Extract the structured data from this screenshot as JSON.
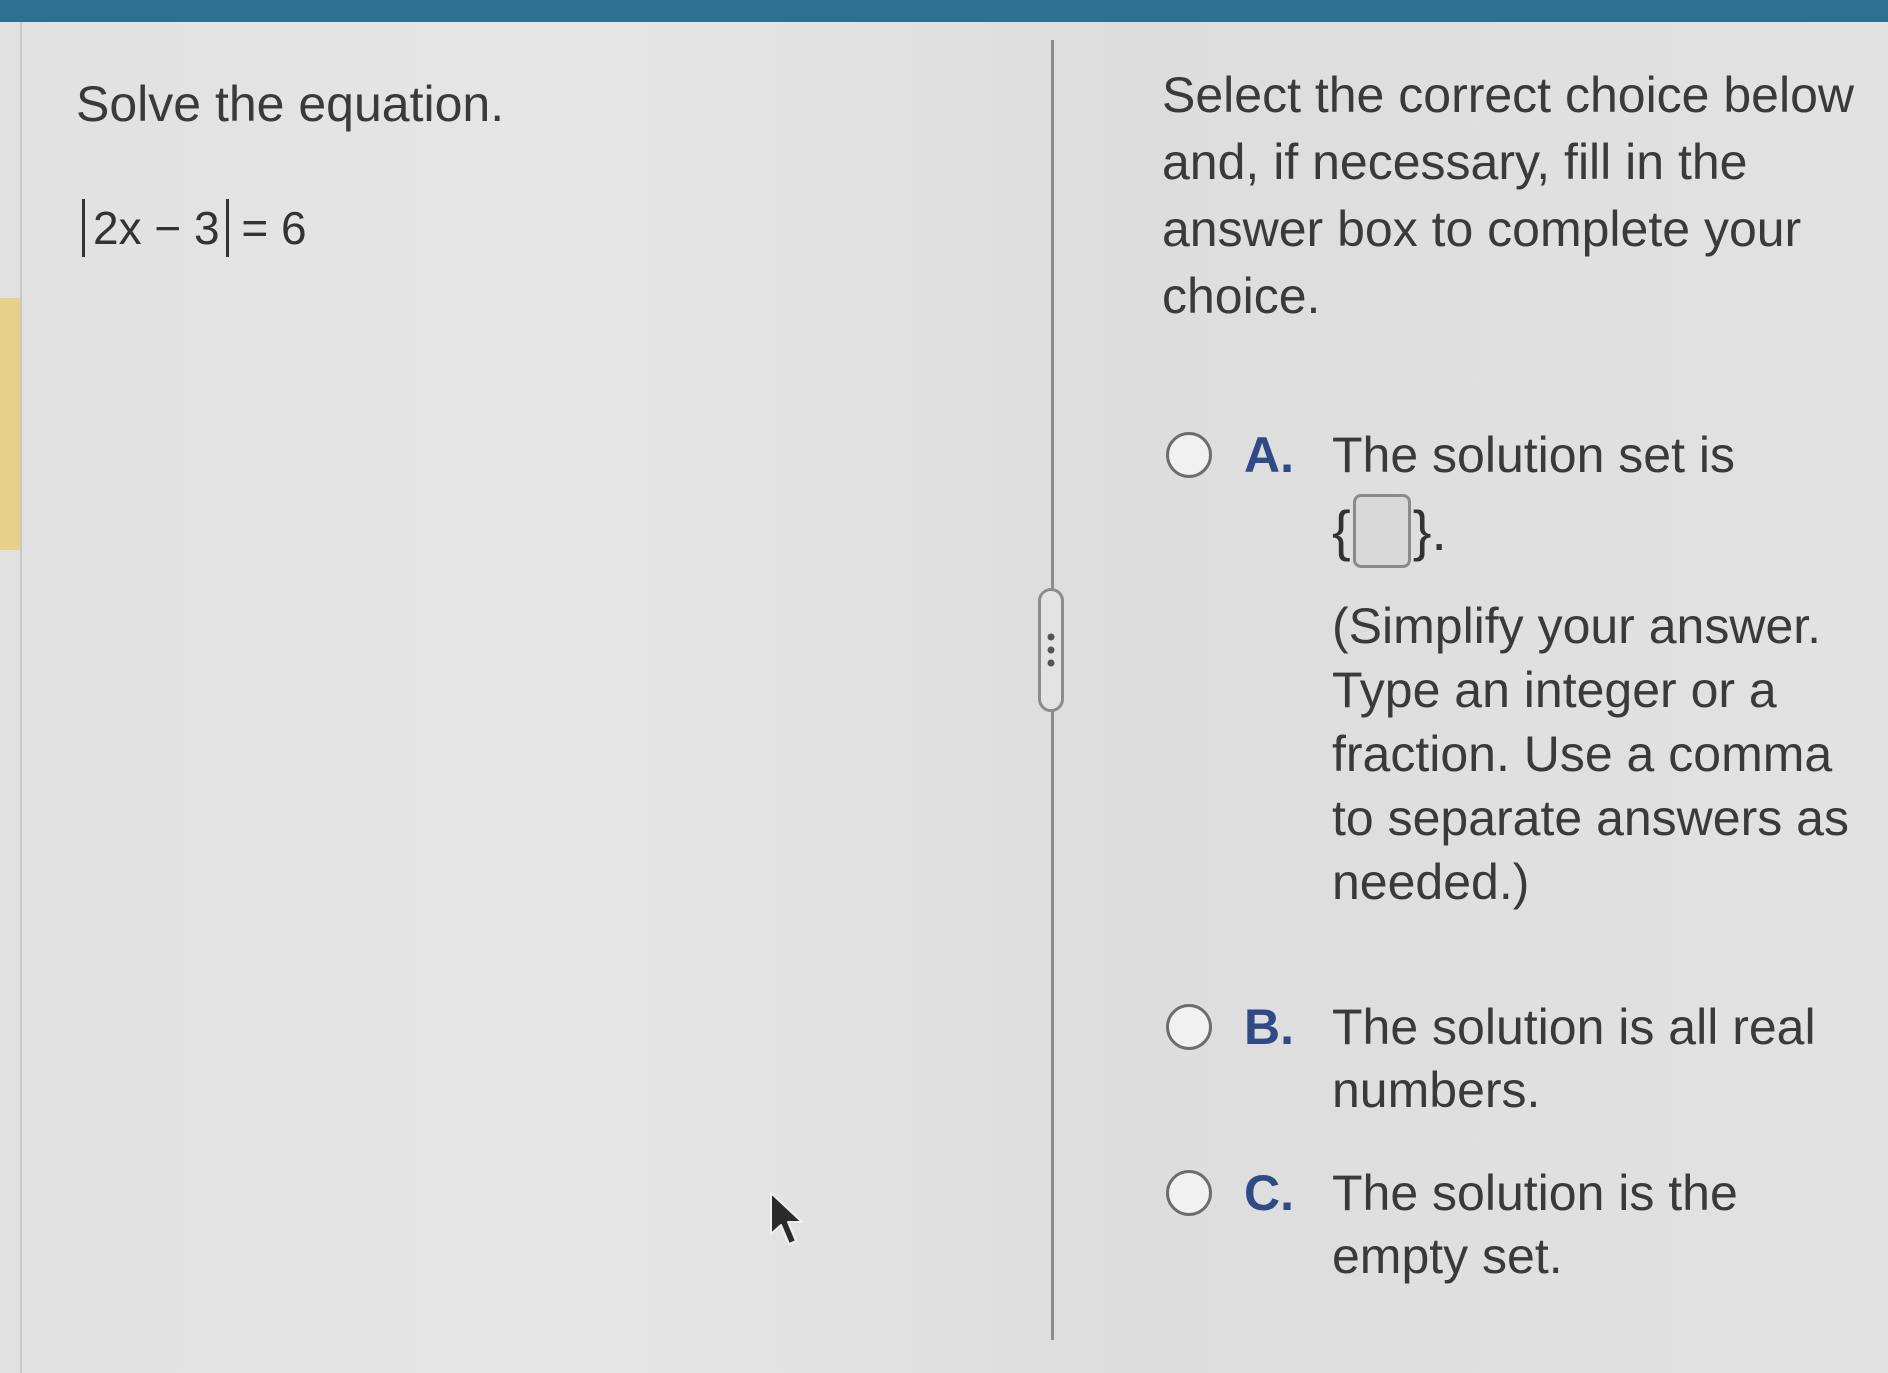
{
  "question": {
    "prompt": "Solve the equation.",
    "equation_inner": "2x − 3",
    "equation_rhs": "= 6"
  },
  "instructions": "Select the correct choice below and, if necessary, fill in the answer box to complete your choice.",
  "choices": [
    {
      "letter": "A.",
      "text": "The solution set is",
      "set_open": "{",
      "set_close": "}.",
      "answer_value": "",
      "hint": "(Simplify your answer. Type an integer or a fraction. Use a comma to separate answers as needed.)"
    },
    {
      "letter": "B.",
      "text": "The solution is all real numbers."
    },
    {
      "letter": "C.",
      "text": "The solution is the empty set."
    }
  ],
  "colors": {
    "top_bar": "#2f6f92",
    "choice_letter": "#2f4a84",
    "left_accent": "#e6cf86"
  },
  "icons": {
    "divider_handle": "vertical-ellipsis-icon",
    "cursor": "mouse-pointer-icon"
  }
}
